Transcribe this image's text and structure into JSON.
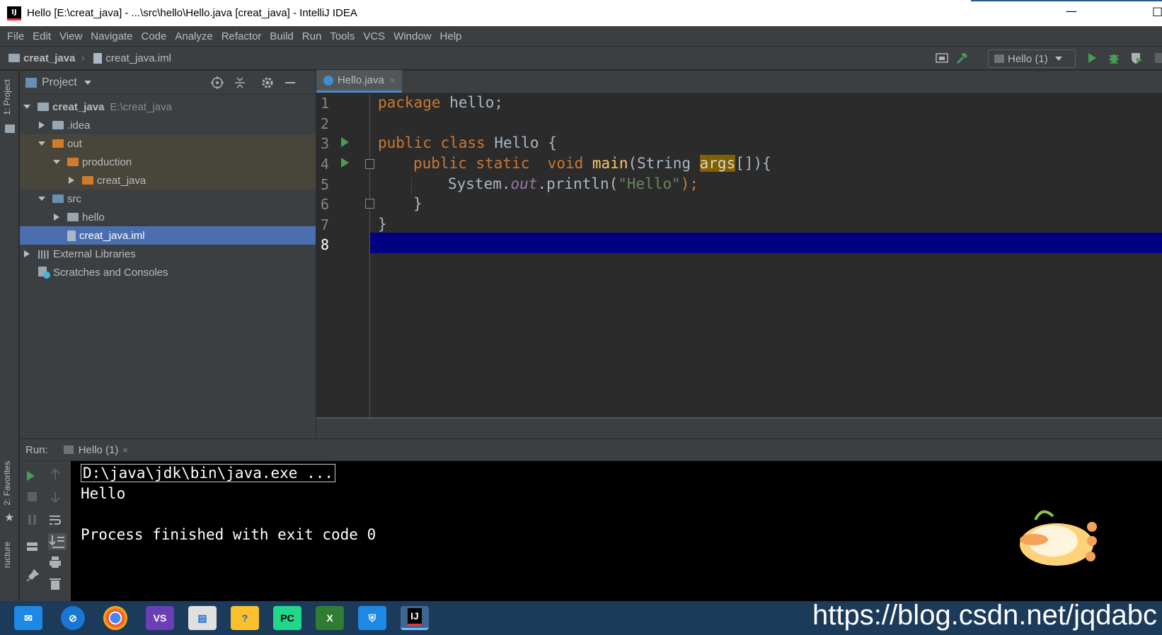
{
  "window": {
    "title": "Hello [E:\\creat_java] - ...\\src\\hello\\Hello.java [creat_java] - IntelliJ IDEA",
    "app_icon_text": "IJ",
    "minimize_glyph": "—",
    "maximize_glyph": "□"
  },
  "menu": [
    "File",
    "Edit",
    "View",
    "Navigate",
    "Code",
    "Analyze",
    "Refactor",
    "Build",
    "Run",
    "Tools",
    "VCS",
    "Window",
    "Help"
  ],
  "breadcrumb": {
    "project": "creat_java",
    "file": "creat_java.iml"
  },
  "toolbar": {
    "run_config": "Hello (1)"
  },
  "side_tabs": {
    "project": "1: Project",
    "favorites": "2: Favorites",
    "structure": "ructure"
  },
  "project_panel": {
    "title": "Project",
    "tree": [
      {
        "label": "creat_java",
        "path": "E:\\creat_java"
      },
      {
        "label": ".idea"
      },
      {
        "label": "out"
      },
      {
        "label": "production"
      },
      {
        "label": "creat_java"
      },
      {
        "label": "src"
      },
      {
        "label": "hello"
      },
      {
        "label": "creat_java.iml"
      },
      {
        "label": "External Libraries"
      },
      {
        "label": "Scratches and Consoles"
      }
    ]
  },
  "editor": {
    "tab": "Hello.java",
    "line_numbers": [
      "1",
      "2",
      "3",
      "4",
      "5",
      "6",
      "7",
      "8"
    ],
    "code": {
      "l1_kw": "package",
      "l1_rest": " hello;",
      "l3_kw": "public class",
      "l3_rest": " Hello {",
      "l4_kw1": "public static",
      "l4_kw2": "void",
      "l4_fn": "main",
      "l4_mid": "(String ",
      "l4_hl": "args",
      "l4_end": "[]){",
      "l5_a": "System.",
      "l5_fld": "out",
      "l5_b": ".println(",
      "l5_str": "\"Hello\"",
      "l5_c": ");",
      "l6": "}",
      "l7": "}"
    }
  },
  "run_panel": {
    "label": "Run:",
    "tab": "Hello (1)",
    "console": [
      "D:\\java\\jdk\\bin\\java.exe ...",
      "Hello",
      "",
      "Process finished with exit code 0"
    ]
  },
  "taskbar": {
    "apps": [
      "mail",
      "browser",
      "chrome",
      "visual-studio",
      "file",
      "help",
      "pycharm",
      "excel",
      "security",
      "intellij"
    ],
    "watermark": "https://blog.csdn.net/jqdabc"
  },
  "colors": {
    "keyword": "#cc7832",
    "string": "#6a8759",
    "field": "#9876aa",
    "selection": "#4b6eaf",
    "current_line": "#000080"
  }
}
